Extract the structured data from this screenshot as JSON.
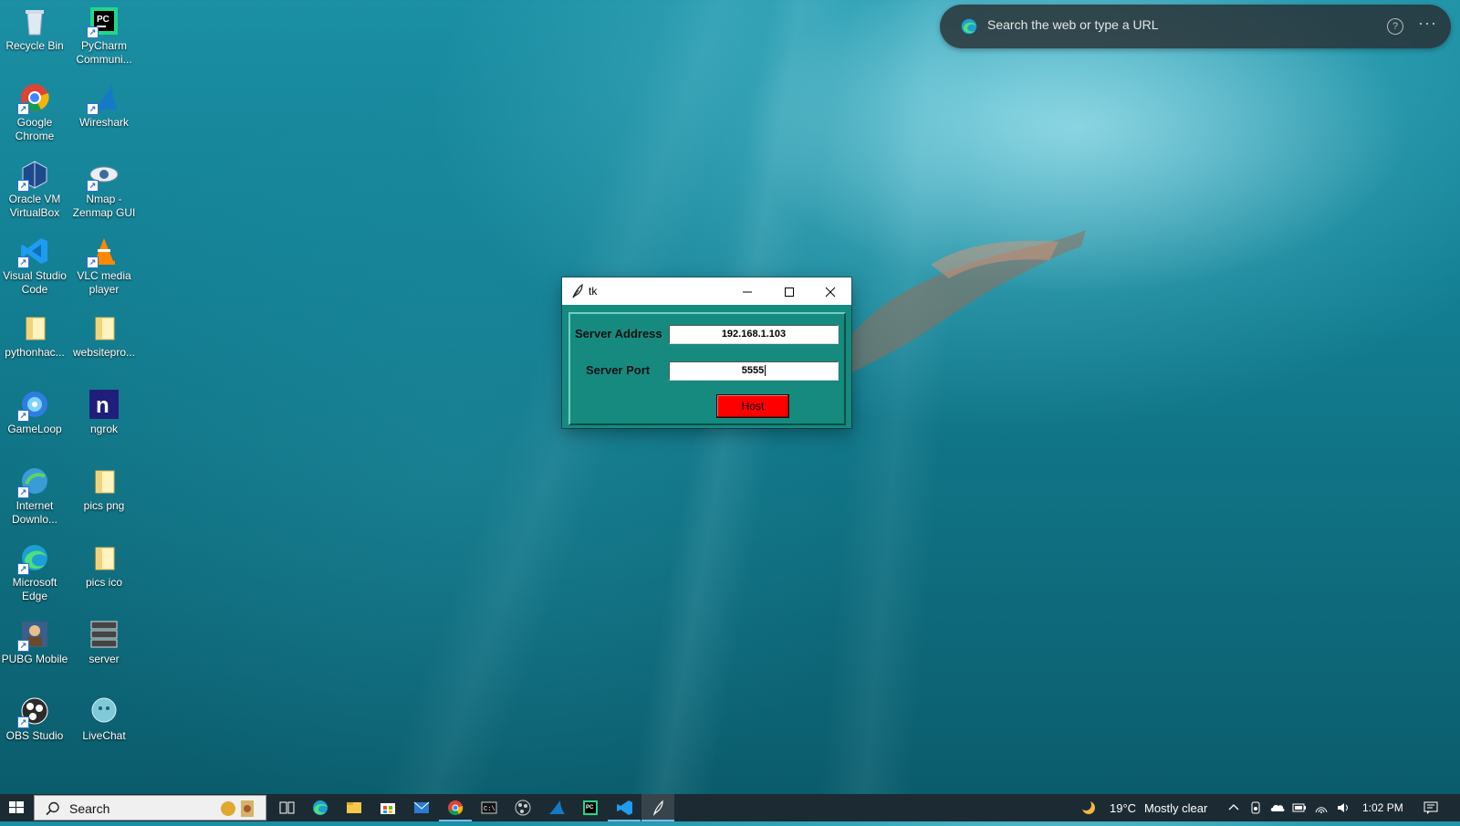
{
  "desktop": {
    "icons": [
      {
        "label": "Recycle Bin",
        "icon": "recycle-bin-icon"
      },
      {
        "label": "PyCharm Communi...",
        "icon": "pycharm-icon"
      },
      {
        "label": "Google Chrome",
        "icon": "chrome-icon"
      },
      {
        "label": "Wireshark",
        "icon": "wireshark-icon"
      },
      {
        "label": "Oracle VM VirtualBox",
        "icon": "virtualbox-icon"
      },
      {
        "label": "Nmap - Zenmap GUI",
        "icon": "zenmap-icon"
      },
      {
        "label": "Visual Studio Code",
        "icon": "vscode-icon"
      },
      {
        "label": "VLC media player",
        "icon": "vlc-icon"
      },
      {
        "label": "pythonhac...",
        "icon": "folder-icon"
      },
      {
        "label": "websitepro...",
        "icon": "folder-icon"
      },
      {
        "label": "GameLoop",
        "icon": "gameloop-icon"
      },
      {
        "label": "ngrok",
        "icon": "ngrok-icon"
      },
      {
        "label": "Internet Downlo...",
        "icon": "idm-icon"
      },
      {
        "label": "pics png",
        "icon": "folder-icon"
      },
      {
        "label": "Microsoft Edge",
        "icon": "edge-icon"
      },
      {
        "label": "pics ico",
        "icon": "folder-icon"
      },
      {
        "label": "PUBG Mobile",
        "icon": "pubg-icon"
      },
      {
        "label": "server",
        "icon": "server-icon"
      },
      {
        "label": "OBS Studio",
        "icon": "obs-icon"
      },
      {
        "label": "LiveChat",
        "icon": "livechat-icon"
      }
    ]
  },
  "edge_search": {
    "placeholder": "Search the web or type a URL",
    "help": "?",
    "more": "···"
  },
  "tk_window": {
    "title": "tk",
    "server_address_label": "Server Address",
    "server_address_value": "192.168.1.103",
    "server_port_label": "Server Port",
    "server_port_value": "5555",
    "host_button": "Host",
    "colors": {
      "background": "#168a7f",
      "button": "#ff0000"
    }
  },
  "taskbar": {
    "search_placeholder": "Search",
    "pinned": [
      "task-view-icon",
      "edge-icon",
      "file-explorer-icon",
      "store-icon",
      "mail-icon",
      "chrome-icon",
      "terminal-icon",
      "obs-icon",
      "wireshark-icon",
      "pycharm-icon",
      "vscode-icon",
      "tk-feather-icon"
    ],
    "weather_temp": "19°C",
    "weather_text": "Mostly clear",
    "clock": "1:02 PM"
  }
}
